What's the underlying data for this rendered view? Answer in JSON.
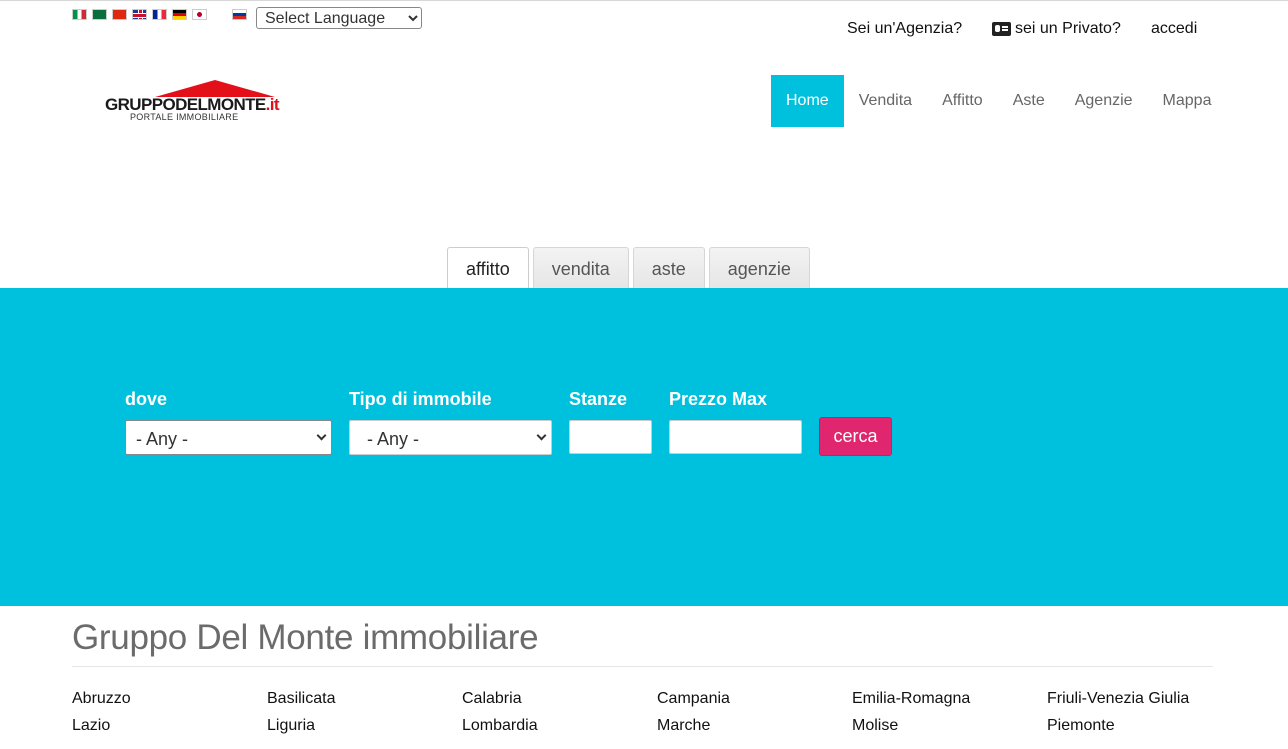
{
  "language": {
    "flags": [
      "it",
      "ar",
      "zh",
      "en",
      "fr",
      "de",
      "ja",
      "ru"
    ],
    "select_value": "Select Language"
  },
  "top_links": {
    "agency": "Sei un'Agenzia?",
    "private": "sei un Privato?",
    "login": "accedi"
  },
  "logo": {
    "main": "GRUPPODELMONTE",
    "tld": ".it",
    "sub": "PORTALE IMMOBILIARE"
  },
  "nav": [
    "Home",
    "Vendita",
    "Affitto",
    "Aste",
    "Agenzie",
    "Mappa"
  ],
  "nav_active": "Home",
  "tabs": [
    "affitto",
    "vendita",
    "aste",
    "agenzie"
  ],
  "tab_active": "affitto",
  "search": {
    "dove_label": "dove",
    "dove_value": "- Any -",
    "tipo_label": "Tipo di immobile",
    "tipo_value": "- Any -",
    "stanze_label": "Stanze",
    "stanze_value": "",
    "prezzo_label": "Prezzo Max",
    "prezzo_value": "",
    "button": "cerca"
  },
  "section_title": "Gruppo Del Monte immobiliare",
  "regions": [
    "Abruzzo",
    "Basilicata",
    "Calabria",
    "Campania",
    "Emilia-Romagna",
    "Friuli-Venezia Giulia",
    "Lazio",
    "Liguria",
    "Lombardia",
    "Marche",
    "Molise",
    "Piemonte"
  ],
  "colors": {
    "accent": "#00c1dd",
    "button": "#e0266e",
    "logo_red": "#e3101a"
  }
}
